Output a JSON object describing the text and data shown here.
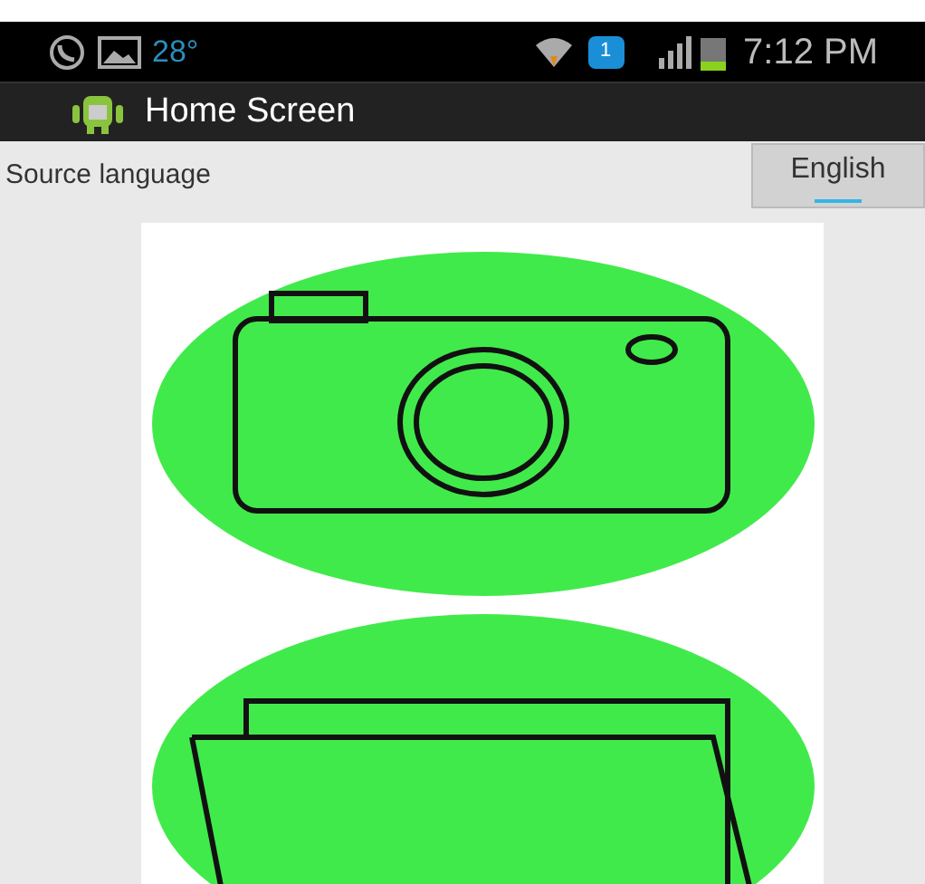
{
  "status_bar": {
    "temperature": "28°",
    "notification_count": "1",
    "time": "7:12 PM"
  },
  "action_bar": {
    "title": "Home Screen"
  },
  "source_language": {
    "label": "Source language",
    "value": "English"
  }
}
